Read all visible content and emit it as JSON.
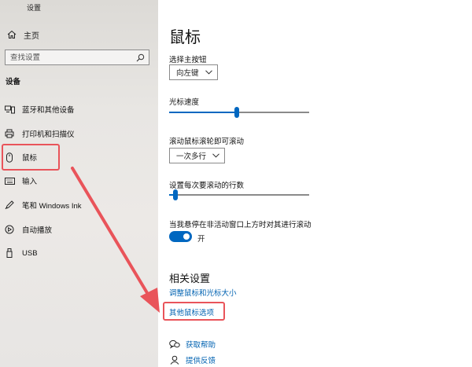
{
  "app": {
    "title": "设置"
  },
  "nav": {
    "home_label": "主页",
    "search_placeholder": "查找设置",
    "section_label": "设备",
    "items": [
      {
        "label": "蓝牙和其他设备",
        "icon": "bluetooth-devices-icon"
      },
      {
        "label": "打印机和扫描仪",
        "icon": "printer-icon"
      },
      {
        "label": "鼠标",
        "icon": "mouse-icon",
        "selected": true
      },
      {
        "label": "输入",
        "icon": "keyboard-icon"
      },
      {
        "label": "笔和 Windows Ink",
        "icon": "pen-icon"
      },
      {
        "label": "自动播放",
        "icon": "autoplay-icon"
      },
      {
        "label": "USB",
        "icon": "usb-icon"
      }
    ]
  },
  "main": {
    "title": "鼠标",
    "primary_button": {
      "label": "选择主按钮",
      "value": "向左键"
    },
    "cursor_speed": {
      "label": "光标速度",
      "level_percent": 48
    },
    "scroll_mode": {
      "label": "滚动鼠标滚轮即可滚动",
      "value": "一次多行"
    },
    "lines_per_scroll": {
      "label": "设置每次要滚动的行数",
      "level_percent": 3
    },
    "inactive_scroll": {
      "label": "当我悬停在非活动窗口上方时对其进行滚动",
      "toggle_on": true,
      "toggle_label": "开"
    },
    "related": {
      "heading": "相关设置",
      "links": [
        "调整鼠标和光标大小",
        "其他鼠标选项"
      ]
    },
    "help": {
      "get_help": "获取帮助",
      "feedback": "提供反馈"
    }
  },
  "colors": {
    "accent": "#0067c0",
    "link": "#0062b1",
    "annotation": "#e9545a",
    "nav_background": "#e8e6e3"
  }
}
